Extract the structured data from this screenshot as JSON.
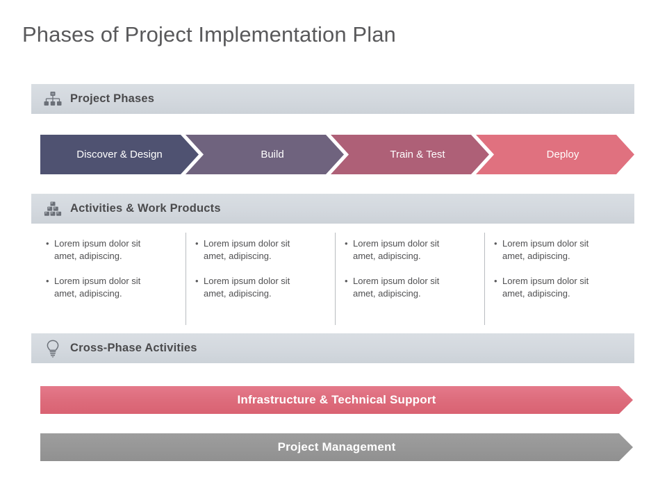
{
  "slide": {
    "title": "Phases of Project Implementation Plan"
  },
  "sections": {
    "phases": {
      "label": "Project Phases",
      "icon": "org-chart-icon"
    },
    "activities": {
      "label": "Activities & Work Products",
      "icon": "blocks-stack-icon"
    },
    "cross_phase": {
      "label": "Cross-Phase Activities",
      "icon": "lightbulb-icon"
    }
  },
  "phase_arrows": [
    {
      "label": "Discover & Design",
      "color": "#4f5271"
    },
    {
      "label": "Build",
      "color": "#6f637e"
    },
    {
      "label": "Train & Test",
      "color": "#ae6077"
    },
    {
      "label": "Deploy",
      "color": "#e0717f"
    }
  ],
  "activity_columns": [
    {
      "bullets": [
        "Lorem ipsum dolor sit amet, adipiscing.",
        "Lorem ipsum dolor sit amet, adipiscing."
      ]
    },
    {
      "bullets": [
        "Lorem ipsum dolor sit amet, adipiscing.",
        "Lorem ipsum dolor sit amet, adipiscing."
      ]
    },
    {
      "bullets": [
        "Lorem ipsum dolor sit amet, adipiscing.",
        "Lorem ipsum dolor sit amet, adipiscing."
      ]
    },
    {
      "bullets": [
        "Lorem ipsum dolor sit amet, adipiscing.",
        "Lorem ipsum dolor sit amet, adipiscing."
      ]
    }
  ],
  "cross_phase_banners": [
    {
      "label": "Infrastructure & Technical Support",
      "color": "#dd6c7c"
    },
    {
      "label": "Project Management",
      "color": "#979797"
    }
  ],
  "bullet_glyph": "•",
  "colors": {
    "section_bar": "#d4d9df",
    "title_text": "#59595b",
    "divider": "#b9bcc0",
    "background": "#ffffff"
  }
}
